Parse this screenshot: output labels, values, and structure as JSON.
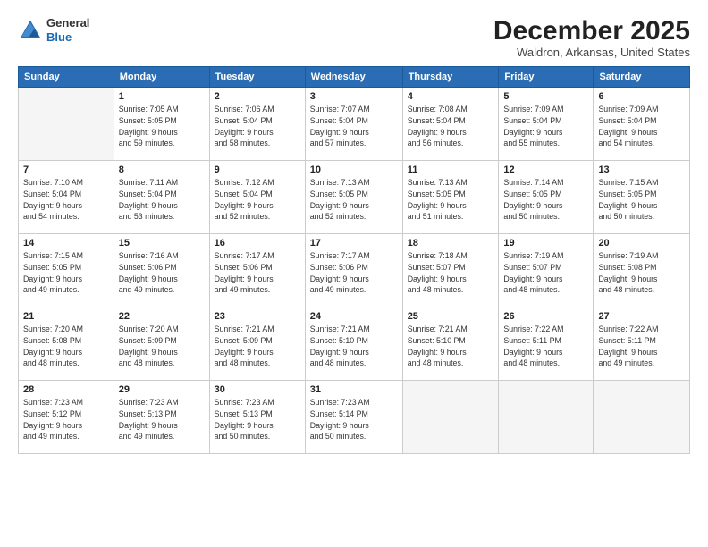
{
  "header": {
    "logo_line1": "General",
    "logo_line2": "Blue",
    "month_title": "December 2025",
    "location": "Waldron, Arkansas, United States"
  },
  "days_of_week": [
    "Sunday",
    "Monday",
    "Tuesday",
    "Wednesday",
    "Thursday",
    "Friday",
    "Saturday"
  ],
  "weeks": [
    [
      {
        "day": "",
        "info": ""
      },
      {
        "day": "1",
        "info": "Sunrise: 7:05 AM\nSunset: 5:05 PM\nDaylight: 9 hours\nand 59 minutes."
      },
      {
        "day": "2",
        "info": "Sunrise: 7:06 AM\nSunset: 5:04 PM\nDaylight: 9 hours\nand 58 minutes."
      },
      {
        "day": "3",
        "info": "Sunrise: 7:07 AM\nSunset: 5:04 PM\nDaylight: 9 hours\nand 57 minutes."
      },
      {
        "day": "4",
        "info": "Sunrise: 7:08 AM\nSunset: 5:04 PM\nDaylight: 9 hours\nand 56 minutes."
      },
      {
        "day": "5",
        "info": "Sunrise: 7:09 AM\nSunset: 5:04 PM\nDaylight: 9 hours\nand 55 minutes."
      },
      {
        "day": "6",
        "info": "Sunrise: 7:09 AM\nSunset: 5:04 PM\nDaylight: 9 hours\nand 54 minutes."
      }
    ],
    [
      {
        "day": "7",
        "info": "Sunrise: 7:10 AM\nSunset: 5:04 PM\nDaylight: 9 hours\nand 54 minutes."
      },
      {
        "day": "8",
        "info": "Sunrise: 7:11 AM\nSunset: 5:04 PM\nDaylight: 9 hours\nand 53 minutes."
      },
      {
        "day": "9",
        "info": "Sunrise: 7:12 AM\nSunset: 5:04 PM\nDaylight: 9 hours\nand 52 minutes."
      },
      {
        "day": "10",
        "info": "Sunrise: 7:13 AM\nSunset: 5:05 PM\nDaylight: 9 hours\nand 52 minutes."
      },
      {
        "day": "11",
        "info": "Sunrise: 7:13 AM\nSunset: 5:05 PM\nDaylight: 9 hours\nand 51 minutes."
      },
      {
        "day": "12",
        "info": "Sunrise: 7:14 AM\nSunset: 5:05 PM\nDaylight: 9 hours\nand 50 minutes."
      },
      {
        "day": "13",
        "info": "Sunrise: 7:15 AM\nSunset: 5:05 PM\nDaylight: 9 hours\nand 50 minutes."
      }
    ],
    [
      {
        "day": "14",
        "info": "Sunrise: 7:15 AM\nSunset: 5:05 PM\nDaylight: 9 hours\nand 49 minutes."
      },
      {
        "day": "15",
        "info": "Sunrise: 7:16 AM\nSunset: 5:06 PM\nDaylight: 9 hours\nand 49 minutes."
      },
      {
        "day": "16",
        "info": "Sunrise: 7:17 AM\nSunset: 5:06 PM\nDaylight: 9 hours\nand 49 minutes."
      },
      {
        "day": "17",
        "info": "Sunrise: 7:17 AM\nSunset: 5:06 PM\nDaylight: 9 hours\nand 49 minutes."
      },
      {
        "day": "18",
        "info": "Sunrise: 7:18 AM\nSunset: 5:07 PM\nDaylight: 9 hours\nand 48 minutes."
      },
      {
        "day": "19",
        "info": "Sunrise: 7:19 AM\nSunset: 5:07 PM\nDaylight: 9 hours\nand 48 minutes."
      },
      {
        "day": "20",
        "info": "Sunrise: 7:19 AM\nSunset: 5:08 PM\nDaylight: 9 hours\nand 48 minutes."
      }
    ],
    [
      {
        "day": "21",
        "info": "Sunrise: 7:20 AM\nSunset: 5:08 PM\nDaylight: 9 hours\nand 48 minutes."
      },
      {
        "day": "22",
        "info": "Sunrise: 7:20 AM\nSunset: 5:09 PM\nDaylight: 9 hours\nand 48 minutes."
      },
      {
        "day": "23",
        "info": "Sunrise: 7:21 AM\nSunset: 5:09 PM\nDaylight: 9 hours\nand 48 minutes."
      },
      {
        "day": "24",
        "info": "Sunrise: 7:21 AM\nSunset: 5:10 PM\nDaylight: 9 hours\nand 48 minutes."
      },
      {
        "day": "25",
        "info": "Sunrise: 7:21 AM\nSunset: 5:10 PM\nDaylight: 9 hours\nand 48 minutes."
      },
      {
        "day": "26",
        "info": "Sunrise: 7:22 AM\nSunset: 5:11 PM\nDaylight: 9 hours\nand 48 minutes."
      },
      {
        "day": "27",
        "info": "Sunrise: 7:22 AM\nSunset: 5:11 PM\nDaylight: 9 hours\nand 49 minutes."
      }
    ],
    [
      {
        "day": "28",
        "info": "Sunrise: 7:23 AM\nSunset: 5:12 PM\nDaylight: 9 hours\nand 49 minutes."
      },
      {
        "day": "29",
        "info": "Sunrise: 7:23 AM\nSunset: 5:13 PM\nDaylight: 9 hours\nand 49 minutes."
      },
      {
        "day": "30",
        "info": "Sunrise: 7:23 AM\nSunset: 5:13 PM\nDaylight: 9 hours\nand 50 minutes."
      },
      {
        "day": "31",
        "info": "Sunrise: 7:23 AM\nSunset: 5:14 PM\nDaylight: 9 hours\nand 50 minutes."
      },
      {
        "day": "",
        "info": ""
      },
      {
        "day": "",
        "info": ""
      },
      {
        "day": "",
        "info": ""
      }
    ]
  ]
}
